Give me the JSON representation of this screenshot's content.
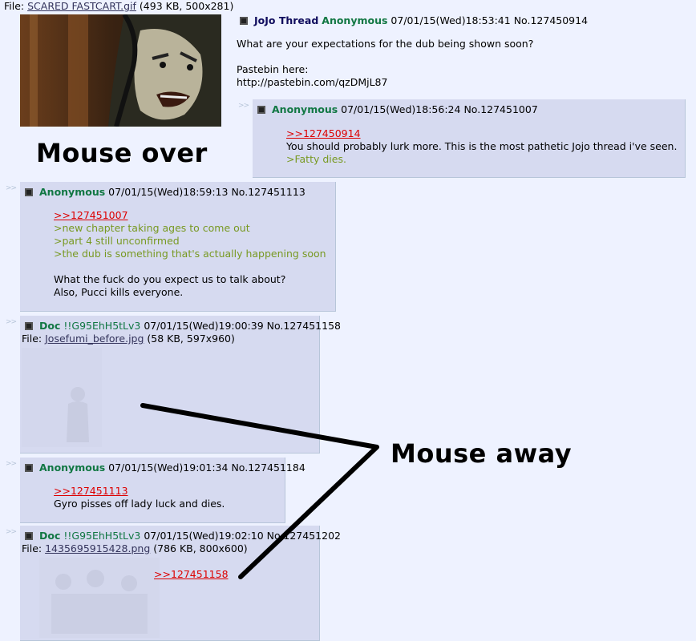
{
  "op": {
    "file_prefix": "File: ",
    "file_name": "SCARED FASTCART.gif",
    "file_info": "(493 KB, 500x281)",
    "subject": "JoJo Thread",
    "name": "Anonymous",
    "datetime": "07/01/15(Wed)18:53:41",
    "number": "No.127450914",
    "body_line1": "What are your expectations for the dub being shown soon?",
    "body_line2": "Pastebin here:",
    "body_line3": "http://pastebin.com/qzDMjL87"
  },
  "captions": {
    "mouse_over": "Mouse over",
    "mouse_away": "Mouse away"
  },
  "side_arrows": ">>",
  "posts": [
    {
      "name": "Anonymous",
      "datetime": "07/01/15(Wed)18:56:24",
      "number": "No.127451007",
      "quote": ">>127450914",
      "text1": "You should probably lurk more. This is the most pathetic Jojo thread i've seen.",
      "green1": ">Fatty dies."
    },
    {
      "name": "Anonymous",
      "datetime": "07/01/15(Wed)18:59:13",
      "number": "No.127451113",
      "quote": ">>127451007",
      "green1": ">new chapter taking ages to come out",
      "green2": ">part 4 still unconfirmed",
      "green3": ">the dub is something that's actually happening soon",
      "text1": "What the fuck do you expect us to talk about?",
      "text2": "Also, Pucci kills everyone."
    },
    {
      "name": "Doc",
      "trip": "!!G95EhH5tLv3",
      "datetime": "07/01/15(Wed)19:00:39",
      "number": "No.127451158",
      "file_prefix": "File: ",
      "file_name": "Josefumi_before.jpg",
      "file_info": "(58 KB, 597x960)"
    },
    {
      "name": "Anonymous",
      "datetime": "07/01/15(Wed)19:01:34",
      "number": "No.127451184",
      "quote": ">>127451113",
      "text1": "Gyro pisses off lady luck and dies."
    },
    {
      "name": "Doc",
      "trip": "!!G95EhH5tLv3",
      "datetime": "07/01/15(Wed)19:02:10",
      "number": "No.127451202",
      "file_prefix": "File: ",
      "file_name": "1435695915428.png",
      "file_info": "(786 KB, 800x600)",
      "quote": ">>127451158"
    }
  ]
}
